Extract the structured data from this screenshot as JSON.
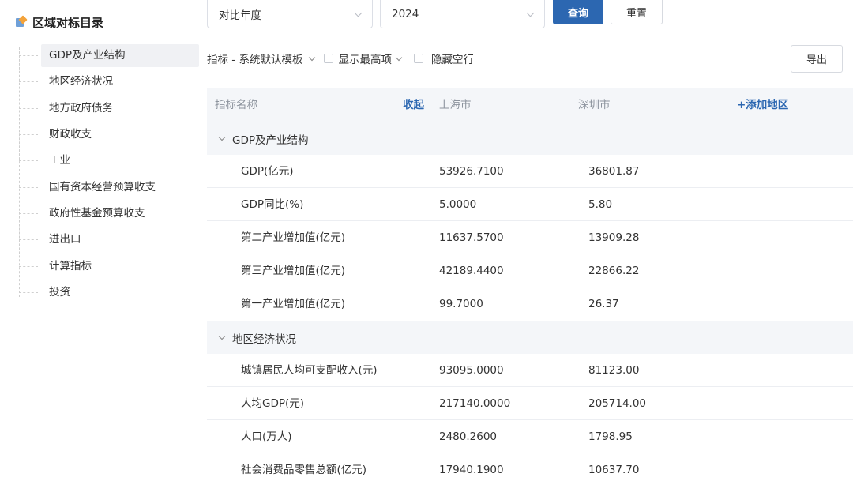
{
  "sidebar": {
    "title": "区域对标目录",
    "items": [
      {
        "label": "GDP及产业结构"
      },
      {
        "label": "地区经济状况"
      },
      {
        "label": "地方政府债务"
      },
      {
        "label": "财政收支"
      },
      {
        "label": "工业"
      },
      {
        "label": "国有资本经营预算收支"
      },
      {
        "label": "政府性基金预算收支"
      },
      {
        "label": "进出口"
      },
      {
        "label": "计算指标"
      },
      {
        "label": "投资"
      }
    ]
  },
  "toolbar": {
    "compare_year_label": "对比年度",
    "year_value": "2024",
    "query_label": "查询",
    "reset_label": "重置"
  },
  "filters": {
    "template_label": "指标 - 系统默认模板",
    "show_highest_label": "显示最高项",
    "hide_empty_label": "隐藏空行",
    "export_label": "导出"
  },
  "table": {
    "headers": {
      "name": "指标名称",
      "collapse": "收起",
      "region1": "上海市",
      "region2": "深圳市",
      "add_region": "+添加地区"
    },
    "groups": [
      {
        "name": "GDP及产业结构",
        "rows": [
          {
            "name": "GDP(亿元)",
            "v1": "53926.7100",
            "v2": "36801.87"
          },
          {
            "name": "GDP同比(%)",
            "v1": "5.0000",
            "v2": "5.80"
          },
          {
            "name": "第二产业增加值(亿元)",
            "v1": "11637.5700",
            "v2": "13909.28"
          },
          {
            "name": "第三产业增加值(亿元)",
            "v1": "42189.4400",
            "v2": "22866.22"
          },
          {
            "name": "第一产业增加值(亿元)",
            "v1": "99.7000",
            "v2": "26.37"
          }
        ]
      },
      {
        "name": "地区经济状况",
        "rows": [
          {
            "name": "城镇居民人均可支配收入(元)",
            "v1": "93095.0000",
            "v2": "81123.00"
          },
          {
            "name": "人均GDP(元)",
            "v1": "217140.0000",
            "v2": "205714.00"
          },
          {
            "name": "人口(万人)",
            "v1": "2480.2600",
            "v2": "1798.95"
          },
          {
            "name": "社会消费品零售总额(亿元)",
            "v1": "17940.1900",
            "v2": "10637.70"
          }
        ]
      }
    ]
  },
  "colors": {
    "primary": "#2c67b1",
    "header_bg": "#f4f6f9",
    "active_bg": "#f0f1f4"
  }
}
